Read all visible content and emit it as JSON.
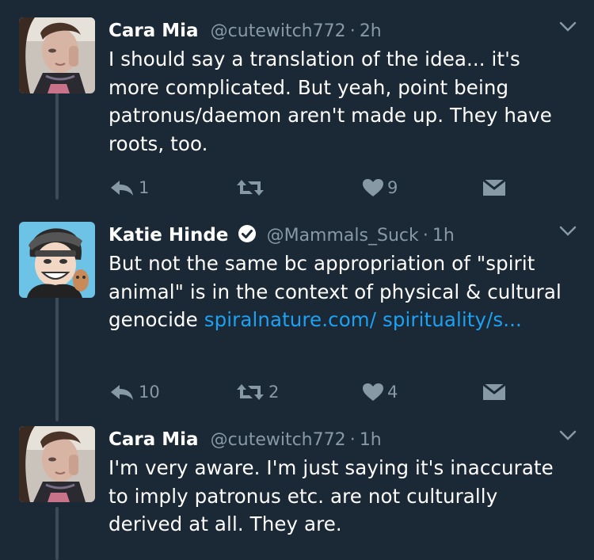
{
  "tweets": [
    {
      "name": "Cara Mia",
      "handle": "@cutewitch772",
      "dot": "·",
      "time": "2h",
      "text": "I should say a translation of the idea... it's more complicated. But yeah, point being patronus/daemon aren't made up. They have roots, too.",
      "link": "",
      "verified": false,
      "replies": "1",
      "retweets": "",
      "likes": "9",
      "icons": [
        "reply-icon",
        "retweet-icon",
        "heart-icon",
        "envelope-icon"
      ]
    },
    {
      "name": "Katie Hinde",
      "handle": "@Mammals_Suck",
      "dot": "·",
      "time": "1h",
      "text": "But not the same bc appropriation of \"spirit animal\" is in the context of physical & cultural genocide ",
      "link": "spiralnature.com/ spirituality/s...",
      "verified": true,
      "replies": "10",
      "retweets": "2",
      "likes": "4",
      "icons": [
        "reply-icon",
        "retweet-icon",
        "heart-icon",
        "envelope-icon"
      ]
    },
    {
      "name": "Cara Mia",
      "handle": "@cutewitch772",
      "dot": "·",
      "time": "1h",
      "text": "I'm very aware. I'm just saying it's inaccurate to imply patronus etc. are not culturally derived at all. They are.",
      "link": "",
      "verified": false,
      "replies": "",
      "retweets": "",
      "likes": "",
      "icons": [
        "reply-icon",
        "retweet-icon",
        "heart-icon",
        "envelope-icon"
      ]
    }
  ],
  "colors": {
    "background": "#1b2836",
    "secondary_text": "#8899a6",
    "link": "#1da1f2",
    "thread_line": "#3d4a57"
  }
}
